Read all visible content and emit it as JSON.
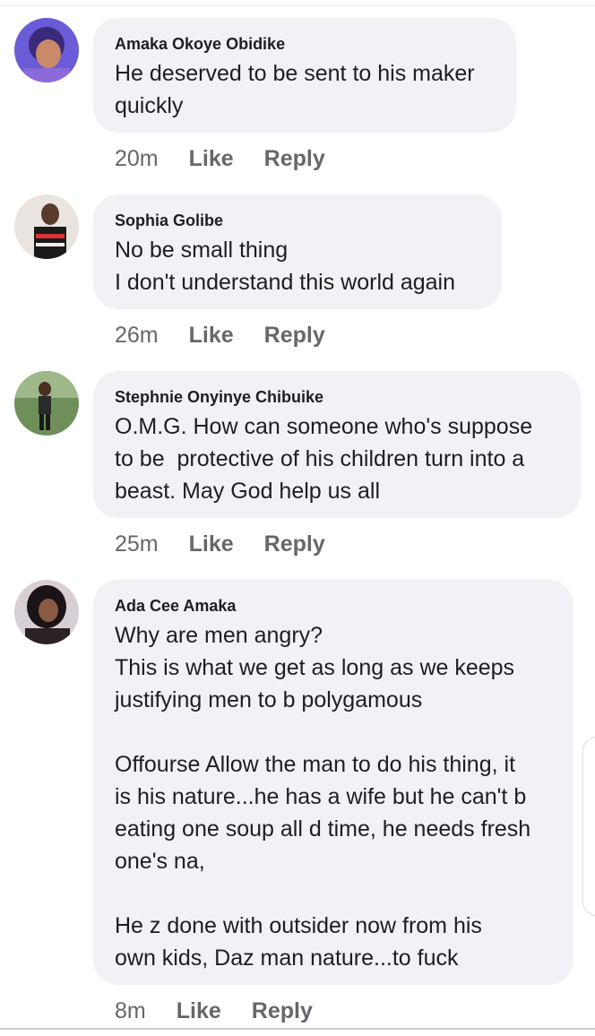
{
  "comments": [
    {
      "author": "Amaka Okoye Obidike",
      "text": "He deserved to be sent to his maker\nquickly",
      "time": "20m",
      "like": "Like",
      "reply": "Reply"
    },
    {
      "author": "Sophia Golibe",
      "text": "No be small thing\nI don't understand this world again",
      "time": "26m",
      "like": "Like",
      "reply": "Reply"
    },
    {
      "author": "Stephnie Onyinye Chibuike",
      "text": "O.M.G. How can someone who's suppose\nto be  protective of his children turn into a\nbeast. May God help us all",
      "time": "25m",
      "like": "Like",
      "reply": "Reply"
    },
    {
      "author": "Ada Cee Amaka",
      "text": "Why are men angry?\nThis is what we get as long as we keeps\njustifying men to b polygamous\n\nOffourse Allow the man to do his thing, it\nis his nature...he has a wife but he can't b\neating one soup all d time, he needs fresh\none's na,\n\nHe z done with outsider now from his\nown kids, Daz man nature...to fuck",
      "time": "8m",
      "like": "Like",
      "reply": "Reply"
    }
  ]
}
